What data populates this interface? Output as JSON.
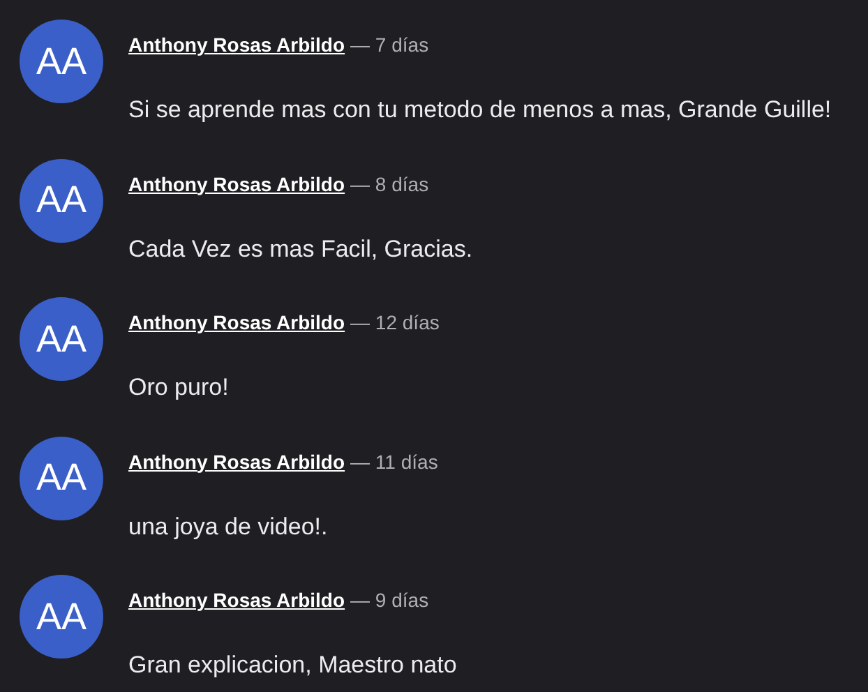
{
  "comments": [
    {
      "initials": "AA",
      "author": "Anthony Rosas Arbildo",
      "time": "— 7 días",
      "text": "Si se aprende mas con tu metodo de menos a mas, Grande Guille!"
    },
    {
      "initials": "AA",
      "author": "Anthony Rosas Arbildo",
      "time": "— 8 días",
      "text": "Cada Vez es mas Facil, Gracias."
    },
    {
      "initials": "AA",
      "author": "Anthony Rosas Arbildo",
      "time": "— 12 días",
      "text": "Oro puro!"
    },
    {
      "initials": "AA",
      "author": "Anthony Rosas Arbildo",
      "time": "— 11 días",
      "text": "una joya de video!."
    },
    {
      "initials": "AA",
      "author": "Anthony Rosas Arbildo",
      "time": "— 9 días",
      "text": "Gran explicacion, Maestro nato"
    }
  ]
}
